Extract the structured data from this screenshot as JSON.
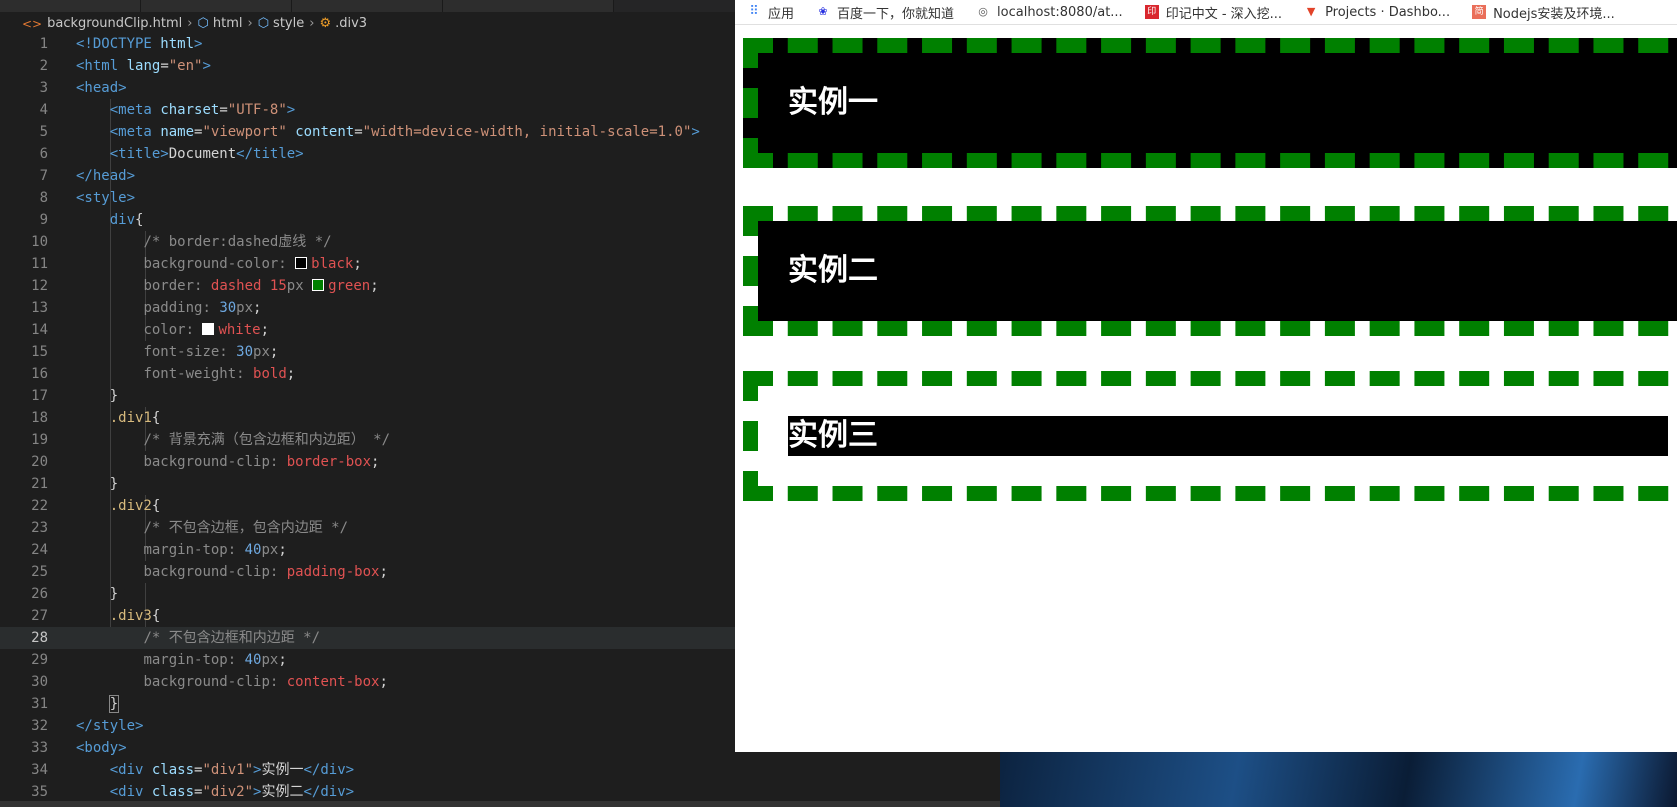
{
  "breadcrumb": {
    "file": "backgroundClip.html",
    "items": [
      "html",
      "style",
      ".div3"
    ]
  },
  "code_lines": [
    {
      "n": "1"
    },
    {
      "n": "2"
    },
    {
      "n": "3"
    },
    {
      "n": "4"
    },
    {
      "n": "5"
    },
    {
      "n": "6"
    },
    {
      "n": "7"
    },
    {
      "n": "8"
    },
    {
      "n": "9"
    },
    {
      "n": "10"
    },
    {
      "n": "11"
    },
    {
      "n": "12"
    },
    {
      "n": "13"
    },
    {
      "n": "14"
    },
    {
      "n": "15"
    },
    {
      "n": "16"
    },
    {
      "n": "17"
    },
    {
      "n": "18"
    },
    {
      "n": "19"
    },
    {
      "n": "20"
    },
    {
      "n": "21"
    },
    {
      "n": "22"
    },
    {
      "n": "23"
    },
    {
      "n": "24"
    },
    {
      "n": "25"
    },
    {
      "n": "26"
    },
    {
      "n": "27"
    },
    {
      "n": "28"
    },
    {
      "n": "29"
    },
    {
      "n": "30"
    },
    {
      "n": "31"
    },
    {
      "n": "32"
    },
    {
      "n": "33"
    },
    {
      "n": "34"
    },
    {
      "n": "35"
    }
  ],
  "bookmarks": [
    {
      "label": "应用"
    },
    {
      "label": "百度一下，你就知道"
    },
    {
      "label": "localhost:8080/at..."
    },
    {
      "label": "印记中文 - 深入挖..."
    },
    {
      "label": "Projects · Dashbo..."
    },
    {
      "label": "Nodejs安装及环境..."
    }
  ],
  "demos": [
    "实例一",
    "实例二",
    "实例三"
  ],
  "colors": {
    "border_green": "#008000",
    "bg_black": "#000000",
    "text_white": "#ffffff"
  }
}
